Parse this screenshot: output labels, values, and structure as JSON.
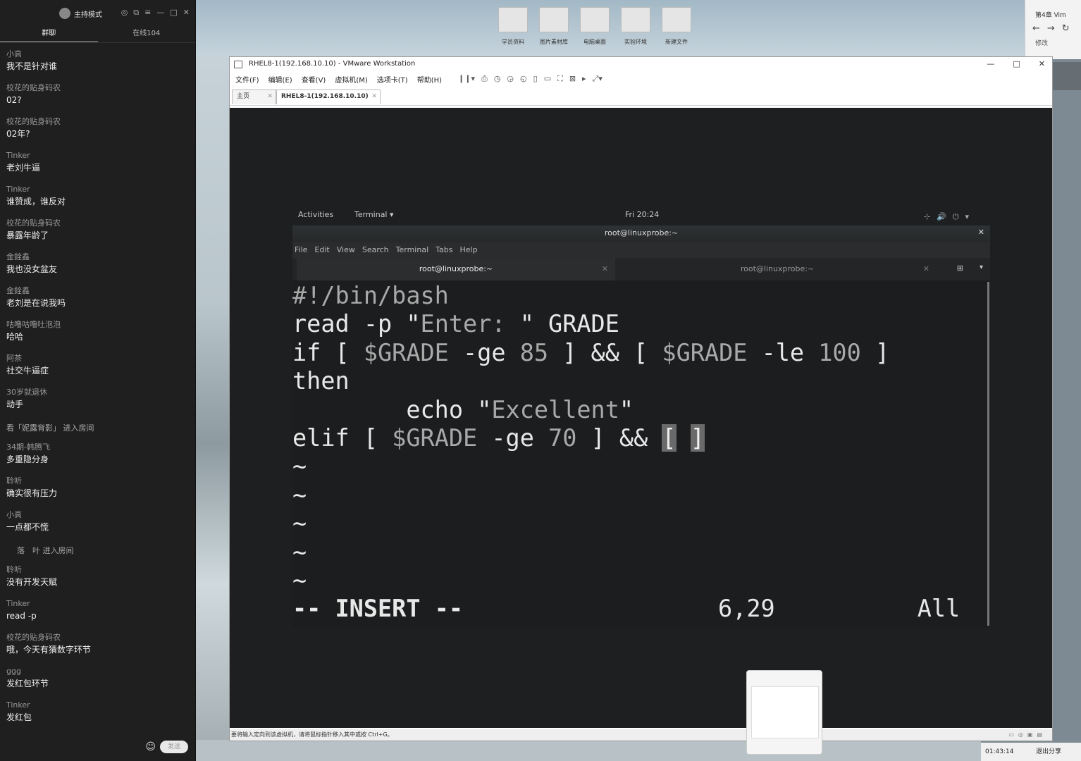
{
  "chat": {
    "mode_label": "主持模式",
    "tabs": [
      "群聊",
      "在线104"
    ],
    "messages": [
      {
        "user": "小高",
        "text": "我不是针对谁"
      },
      {
        "user": "校花的贴身码农",
        "text": "02?"
      },
      {
        "user": "校花的贴身码农",
        "text": "02年?"
      },
      {
        "user": "Tinker",
        "text": "老刘牛逼"
      },
      {
        "user": "Tinker",
        "text": "谁赞成，谁反对"
      },
      {
        "user": "校花的贴身码农",
        "text": "暴露年龄了"
      },
      {
        "user": "金銓鑫",
        "text": "我也没女盆友"
      },
      {
        "user": "金銓鑫",
        "text": "老刘是在说我吗"
      }
    ],
    "messages2": [
      {
        "user": "咕噜咕噜吐泡泡",
        "text": "哈哈"
      },
      {
        "user": "阿茶",
        "text": "社交牛逼症"
      },
      {
        "user": "30岁就退休",
        "text": "动手"
      }
    ],
    "system1": "看「妮露背影」 进入房间",
    "messages3": [
      {
        "user": "34期-韩腾飞",
        "text": "多重隐分身"
      },
      {
        "user": "聆听",
        "text": "确实很有压力"
      },
      {
        "user": "小高",
        "text": "一点都不慌"
      }
    ],
    "system2": "落　叶 进入房间",
    "messages4": [
      {
        "user": "聆听",
        "text": "没有开发天赋"
      },
      {
        "user": "Tinker",
        "text": "read -p"
      },
      {
        "user": "校花的贴身码农",
        "text": "哦，今天有猜数字环节"
      },
      {
        "user": "ggg",
        "text": "发红包环节"
      },
      {
        "user": "Tinker",
        "text": "发红包"
      }
    ],
    "send_label": "发送"
  },
  "desktop_icons": [
    "学员资料",
    "图片素材库",
    "电脑桌面",
    "实验环境",
    "新建文件"
  ],
  "browser": {
    "tab": "第4章 Vim",
    "nav": "←→↻",
    "modify": "修改"
  },
  "vmware": {
    "title": "RHEL8-1(192.168.10.10) - VMware Workstation",
    "menus": [
      "文件(F)",
      "编辑(E)",
      "查看(V)",
      "虚拟机(M)",
      "选项卡(T)",
      "帮助(H)"
    ],
    "tabs": [
      "主页",
      "RHEL8-1(192.168.10.10)"
    ],
    "status": "要将输入定向到该虚拟机，请将鼠标指针移入其中或按 Ctrl+G。"
  },
  "gnome": {
    "activities": "Activities",
    "app": "Terminal ▾",
    "clock": "Fri 20:24"
  },
  "terminal": {
    "title": "root@linuxprobe:~",
    "menu": [
      "File",
      "Edit",
      "View",
      "Search",
      "Terminal",
      "Tabs",
      "Help"
    ],
    "tabs": [
      "root@linuxprobe:~",
      "root@linuxprobe:~"
    ],
    "lines": {
      "l1": "#!/bin/bash",
      "l2a": "read -p \"",
      "l2b": "Enter: ",
      "l2c": "\" GRADE",
      "l3a": "if [ ",
      "l3b": "$GRADE",
      "l3c": " -ge ",
      "l3d": "85",
      "l3e": " ] && [ ",
      "l3f": "$GRADE",
      "l3g": " -le ",
      "l3h": "100",
      "l3i": " ]",
      "l4": "then",
      "l5a": "        echo \"",
      "l5b": "Excellent",
      "l5c": "\"",
      "l6a": "elif [ ",
      "l6b": "$GRADE",
      "l6c": " -ge ",
      "l6d": "70",
      "l6e": " ] && ",
      "l6f": "[",
      "l6g": " ",
      "l6h": "]",
      "tilde": "~",
      "mode": "-- INSERT --",
      "pos": "6,29",
      "all": "All"
    }
  },
  "tray": {
    "time": "01:43:14",
    "exit": "退出分享"
  }
}
